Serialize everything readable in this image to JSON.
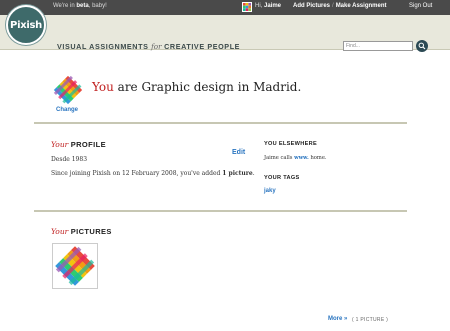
{
  "topbar": {
    "beta_prefix": "We're in ",
    "beta_word": "beta",
    "beta_suffix": ", baby!",
    "greeting": "Hi, ",
    "user_name": "Jaime",
    "add_pictures": "Add Pictures",
    "separator": "/",
    "make_assignment": "Make Assignment",
    "sign_out": "Sign Out"
  },
  "header": {
    "logo_text": "Pixish",
    "tagline_part1": "VISUAL ASSIGNMENTS ",
    "tagline_for": "for",
    "tagline_part2": " CREATIVE PEOPLE",
    "search_placeholder": "Find...",
    "search_icon": "magnifier-icon"
  },
  "hero": {
    "you": "You",
    "statement": " are Graphic design in Madrid.",
    "change_label": "Change"
  },
  "profile": {
    "title_your": "Your",
    "title": " PROFILE",
    "edit_label": "Edit",
    "since_line": "Desde 1983",
    "joined_prefix": "Since joining Pixish on 12 February 2008, you've added ",
    "picture_count": "1 picture",
    "joined_suffix": "."
  },
  "elsewhere": {
    "title": "YOU ELSEWHERE",
    "text_prefix": "Jaime calls ",
    "link": "www.",
    "text_suffix": " home."
  },
  "tags": {
    "title": "YOUR TAGS",
    "items": [
      "jaky"
    ]
  },
  "pictures": {
    "title_your": "Your",
    "title": " PICTURES",
    "more_label": "More »",
    "count_label": "( 1 PICTURE )"
  },
  "colors": {
    "topbar_bg": "#4a4a4a",
    "header_bg": "#e8e8dc",
    "accent_red": "#c02020",
    "link_blue": "#2a75c0",
    "logo_bg": "#3e6a6a"
  }
}
